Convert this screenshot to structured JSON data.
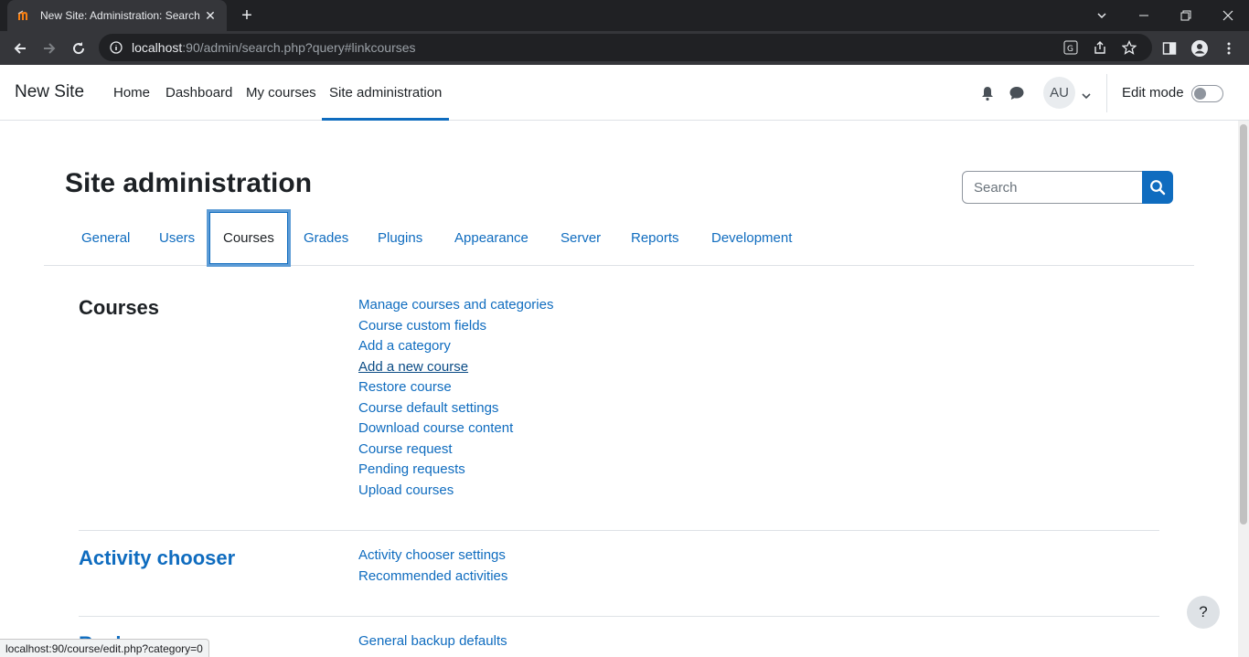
{
  "browser": {
    "tab_title": "New Site: Administration: Search",
    "url_host": "localhost",
    "url_rest": ":90/admin/search.php?query#linkcourses",
    "status_url": "localhost:90/course/edit.php?category=0"
  },
  "navbar": {
    "brand": "New Site",
    "links": [
      "Home",
      "Dashboard",
      "My courses",
      "Site administration"
    ],
    "avatar_initials": "AU",
    "edit_mode_label": "Edit mode"
  },
  "page": {
    "title": "Site administration",
    "search_placeholder": "Search"
  },
  "admin_tabs": [
    "General",
    "Users",
    "Courses",
    "Grades",
    "Plugins",
    "Appearance",
    "Server",
    "Reports",
    "Development"
  ],
  "active_tab": "Courses",
  "sections": [
    {
      "heading": "Courses",
      "links": [
        "Manage courses and categories",
        "Course custom fields",
        "Add a category",
        "Add a new course",
        "Restore course",
        "Course default settings",
        "Download course content",
        "Course request",
        "Pending requests",
        "Upload courses"
      ]
    },
    {
      "heading": "Activity chooser",
      "links": [
        "Activity chooser settings",
        "Recommended activities"
      ]
    },
    {
      "heading": "Backups",
      "links": [
        "General backup defaults"
      ]
    }
  ],
  "help_label": "?",
  "colors": {
    "accent": "#0f6cbf",
    "text": "#1d2125",
    "chrome_dark": "#202124"
  }
}
